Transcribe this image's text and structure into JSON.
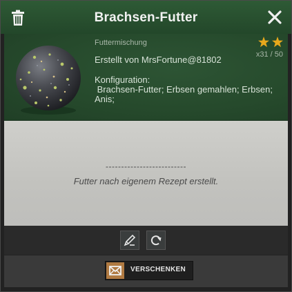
{
  "dialog": {
    "title": "Brachsen-Futter"
  },
  "item": {
    "category": "Futtermischung",
    "creator": "Erstellt von MrsFortune@81802",
    "config_label": "Konfiguration:",
    "config_value": " Brachsen-Futter; Erbsen gemahlen; Erbsen;\nAnis;",
    "rating_stars": 2,
    "star_color": "#e8a81c",
    "count": "x31 / 50"
  },
  "notes": {
    "divider": "--------------------------",
    "text": "Futter nach eigenem Rezept erstellt."
  },
  "footer": {
    "gift_label": "VERSCHENKEN"
  },
  "icons": {
    "delete": "trash-icon",
    "close": "close-icon",
    "edit": "edit-pencil-icon",
    "refresh": "refresh-icon",
    "gift": "envelope-icon"
  },
  "colors": {
    "titlebar": "#2e5a35",
    "panel": "#2b5232",
    "notes": "#c8c8c4",
    "accent": "#b07a42"
  }
}
